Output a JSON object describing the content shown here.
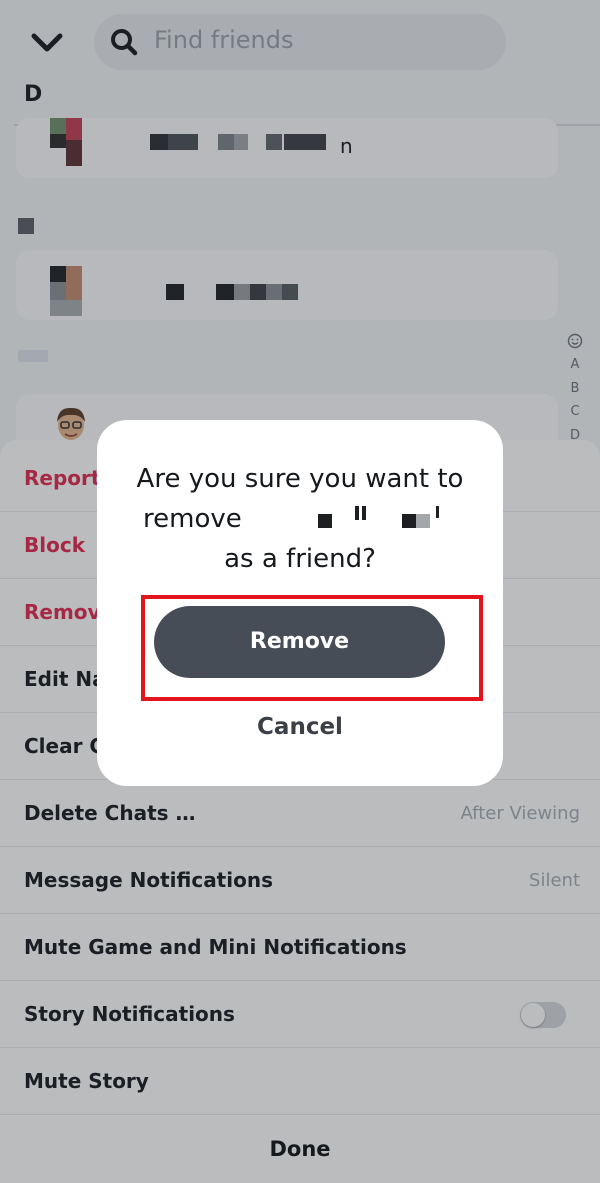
{
  "search": {
    "placeholder": "Find friends"
  },
  "friends_list": {
    "section_letter": "D",
    "friend_name_suffix": "n",
    "alpha_index": [
      "A",
      "B",
      "C",
      "D"
    ]
  },
  "action_sheet": {
    "items": [
      {
        "label": "Report",
        "value": "",
        "style": "red"
      },
      {
        "label": "Block",
        "value": "",
        "style": "red"
      },
      {
        "label": "Remove",
        "value": "",
        "style": "red"
      },
      {
        "label": "Edit Name",
        "value": "",
        "style": "normal"
      },
      {
        "label": "Clear Conversation",
        "value": "",
        "style": "normal"
      },
      {
        "label": "Delete Chats …",
        "value": "After Viewing",
        "style": "normal"
      },
      {
        "label": "Message Notifications",
        "value": "Silent",
        "style": "normal"
      },
      {
        "label": "Mute Game and Mini Notifications",
        "value": "",
        "style": "normal"
      },
      {
        "label": "Story Notifications",
        "value": "",
        "style": "toggle",
        "toggle_on": false
      },
      {
        "label": "Mute Story",
        "value": "",
        "style": "normal"
      }
    ],
    "done_label": "Done"
  },
  "dialog": {
    "line1": "Are you sure you want to",
    "line2_prefix": "remove",
    "line3": "as a friend?",
    "confirm_label": "Remove",
    "cancel_label": "Cancel"
  },
  "colors": {
    "destructive": "#e4264d",
    "primary_button": "#474d57",
    "highlight_outline": "#e3141b"
  }
}
